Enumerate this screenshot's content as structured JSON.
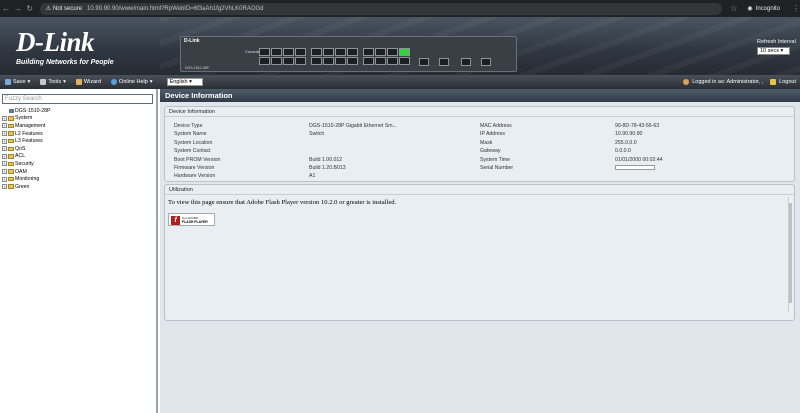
{
  "browser": {
    "security": "Not secure",
    "url": "10.90.90.90/www/main.html?RpWebID=6f3aAh1fg2VhLK0RAOGd",
    "incognito": "Incognito"
  },
  "banner": {
    "logo": "D-Link",
    "tagline": "Building Networks for People",
    "switch_brand": "D-Link",
    "switch_model": "DGS-1510-28P",
    "console_label": "Console",
    "refresh_label": "Refresh Interval",
    "refresh_value": "10 secs"
  },
  "toolbar": {
    "save": "Save",
    "tools": "Tools",
    "wizard": "Wizard",
    "online_help": "Online Help",
    "language": "English",
    "logged_in": "Logged in as: Administrator, ,",
    "logout": "Logout"
  },
  "sidebar": {
    "search_placeholder": "Fuzzy Search",
    "device": "DGS-1510-28P",
    "items": [
      "System",
      "Management",
      "L2 Features",
      "L3 Features",
      "QoS",
      "ACL",
      "Security",
      "OAM",
      "Monitoring",
      "Green"
    ]
  },
  "main": {
    "title": "Device Information",
    "info_panel_title": "Device Information",
    "left_info": [
      {
        "k": "Device Type",
        "v": "DGS-1510-28P Gigabit Ethernet Sm..."
      },
      {
        "k": "System Name",
        "v": "Switch"
      },
      {
        "k": "System Location",
        "v": ""
      },
      {
        "k": "System Contact",
        "v": ""
      },
      {
        "k": "Boot PROM Version",
        "v": "Build 1.00.012"
      },
      {
        "k": "Firmware Version",
        "v": "Build 1.20.B013"
      },
      {
        "k": "Hardware Version",
        "v": "A1"
      }
    ],
    "right_info": [
      {
        "k": "MAC Address",
        "v": "90-8D-78-43-56-63"
      },
      {
        "k": "IP Address",
        "v": "10.90.90.90"
      },
      {
        "k": "Mask",
        "v": "255.0.0.0"
      },
      {
        "k": "Gateway",
        "v": "0.0.0.0"
      },
      {
        "k": "System Time",
        "v": "01/01/2000 00:02:44"
      },
      {
        "k": "Serial Number",
        "v": ""
      }
    ],
    "util_panel_title": "Utilization",
    "flash_message": "To view this page ensure that Adobe Flash Player version 10.2.0 or greater is installed.",
    "flash_badge_top": "Get ADOBE",
    "flash_badge_bottom": "FLASH PLAYER"
  }
}
